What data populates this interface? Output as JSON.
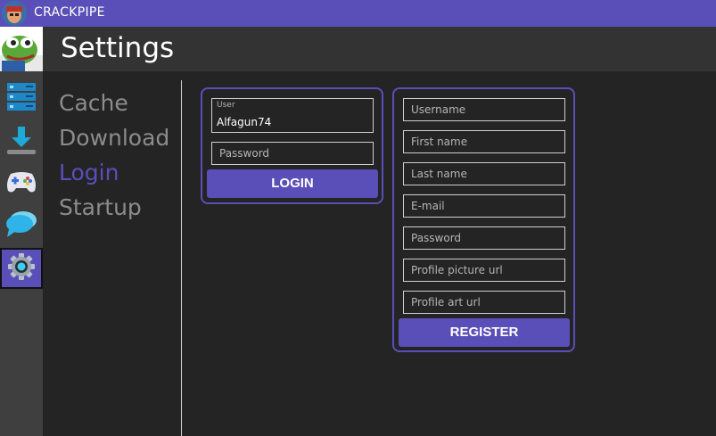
{
  "titlebar": {
    "title": "CRACKPIPE",
    "color": "#5a4fb8"
  },
  "header": {
    "title": "Settings"
  },
  "rail": {
    "items": [
      {
        "icon": "library-icon"
      },
      {
        "icon": "download-icon"
      },
      {
        "icon": "gamepad-icon"
      },
      {
        "icon": "chat-icon"
      },
      {
        "icon": "gear-icon",
        "active": true
      }
    ]
  },
  "nav": {
    "items": [
      {
        "label": "Cache"
      },
      {
        "label": "Download"
      },
      {
        "label": "Login",
        "active": true
      },
      {
        "label": "Startup"
      }
    ]
  },
  "login": {
    "user_label": "User",
    "user_value": "Alfagun74",
    "password_placeholder": "Password",
    "button_label": "LOGIN"
  },
  "register": {
    "fields": [
      "Username",
      "First name",
      "Last name",
      "E-mail",
      "Password",
      "Profile picture url",
      "Profile art url"
    ],
    "button_label": "REGISTER"
  }
}
